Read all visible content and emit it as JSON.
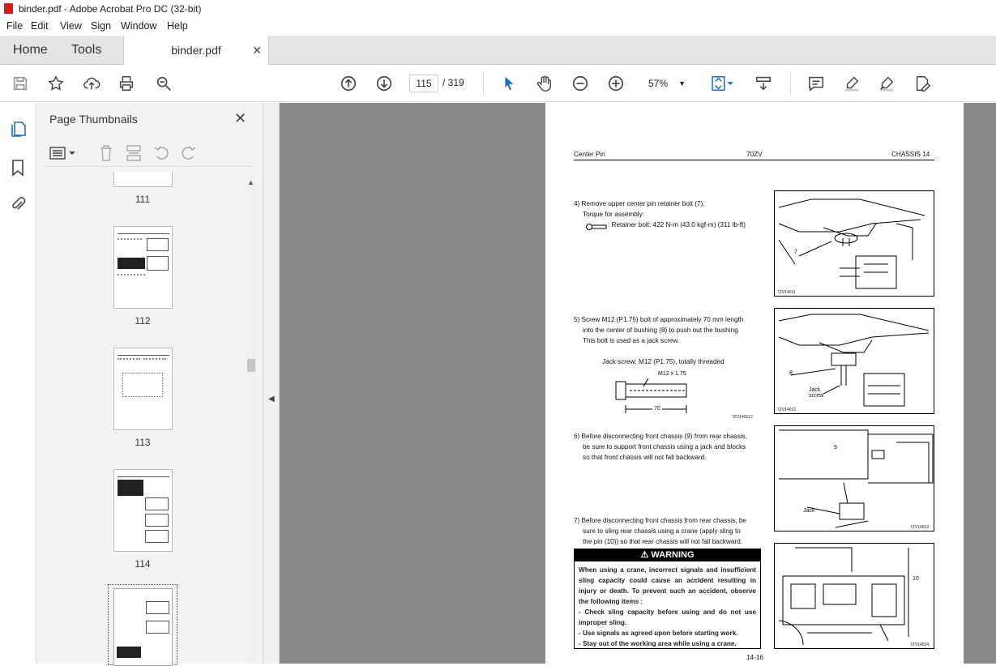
{
  "window": {
    "title": "binder.pdf - Adobe Acrobat Pro DC (32-bit)"
  },
  "menu": [
    "File",
    "Edit",
    "View",
    "Sign",
    "Window",
    "Help"
  ],
  "tabs": {
    "home": "Home",
    "tools": "Tools",
    "file": "binder.pdf"
  },
  "nav": {
    "current_page": "115",
    "total_pages": "/ 319",
    "zoom": "57%"
  },
  "panel": {
    "title": "Page Thumbnails",
    "labels": [
      "111",
      "112",
      "113",
      "114"
    ]
  },
  "doc": {
    "header_left": "Center Pin",
    "header_center": "70ZV",
    "header_right": "CHASSIS  14",
    "step4": "4) Remove upper center pin retainer bolt (7).",
    "torque": "Torque for assembly:",
    "retainer": ": Retainer bolt: 422 N-m (43.0 kgf-m) (311 lb-ft)",
    "step5_1": "5) Screw M12 (P1.75) bolt of approximately 70 mm length",
    "step5_2": "into the center of bushing (8) to push out the bushing.",
    "step5_3": "This bolt is used as a jack screw.",
    "jack_title": "Jack screw: M12 (P1.75), totally threaded",
    "bolt_label": "M12 x 1.75",
    "bolt_len": "70",
    "bolt_cap": "7ZV14012J",
    "step6_1": "6) Before disconnecting front chassis (9) from rear chassis,",
    "step6_2": "be sure to support front chassis using a jack and blocks",
    "step6_3": "so that front chassis will not fall backward.",
    "step7_1": "7) Before disconnecting front chassis from rear chassis, be",
    "step7_2": "sure to sling rear chassis using a crane (apply sling to",
    "step7_3": "the pin (10)) so that rear chassis will not fall backward.",
    "warning_title": "WARNING",
    "warning_1": "When using a crane, incorrect signals and insufficient sling capacity could cause an accident resulting in injury or death.  To prevent such an accident, observe the following items :",
    "warning_2": "- Check sling capacity before using and do not use improper sling.",
    "warning_3": "- Use signals as agreed upon before starting work.",
    "warning_4": "- Stay out of the working area while using a crane.",
    "fig1": {
      "cap": "7ZV14011",
      "label": "7"
    },
    "fig2": {
      "cap": "7ZV14012",
      "label": "8",
      "jack1": "Jack",
      "jack2": "screw"
    },
    "fig3": {
      "cap": "7ZV14013",
      "label": "9",
      "jack": "Jack"
    },
    "fig4": {
      "cap": "7ZV14014",
      "label": "10"
    },
    "page_no": "14-16"
  }
}
